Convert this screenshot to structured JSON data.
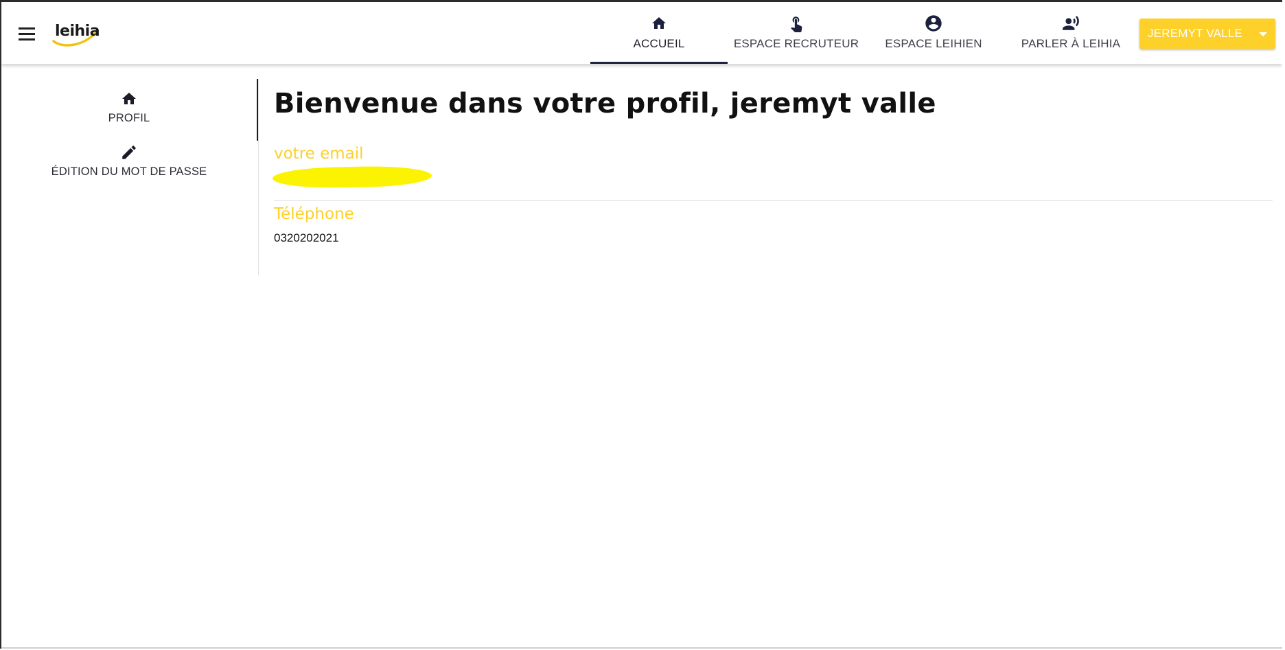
{
  "app": {
    "logo_text": "leihia",
    "accent_color": "#fdd02a",
    "nav_active_color": "#1c2140"
  },
  "topbar": {
    "menu_icon": "hamburger-menu-icon",
    "nav": [
      {
        "label": "ACCUEIL",
        "icon": "home-icon",
        "active": true
      },
      {
        "label": "ESPACE RECRUTEUR",
        "icon": "touch-hand-icon",
        "active": false
      },
      {
        "label": "ESPACE LEIHIEN",
        "icon": "account-circle-icon",
        "active": false
      },
      {
        "label": "PARLER À LEIHIA",
        "icon": "speaker-person-icon",
        "active": false
      }
    ],
    "user_button": {
      "label": "JEREMYT VALLE",
      "icon": "caret-down-icon"
    }
  },
  "sidebar": {
    "items": [
      {
        "label": "PROFIL",
        "icon": "home-icon",
        "active": true
      },
      {
        "label": "ÉDITION DU MOT DE PASSE",
        "icon": "pencil-icon",
        "active": false
      }
    ]
  },
  "profile": {
    "title": "Bienvenue dans votre profil, jeremyt valle",
    "email_label": "votre email",
    "phone_label": "Téléphone",
    "phone_value": "0320202021"
  }
}
